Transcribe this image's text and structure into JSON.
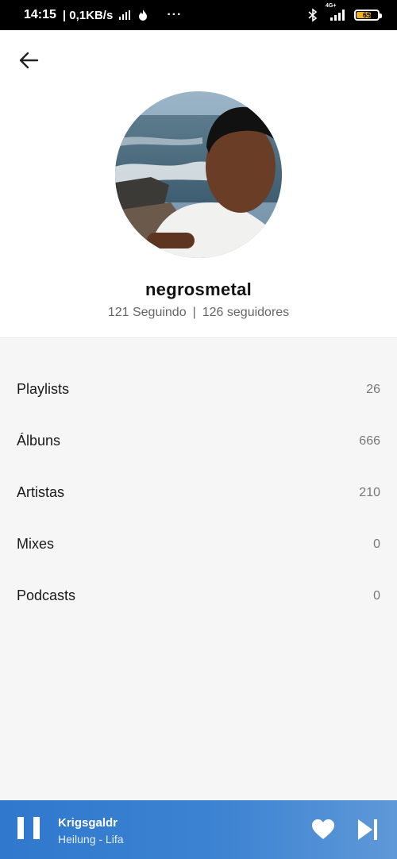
{
  "status_bar": {
    "time": "14:15",
    "network_speed": "| 0,1KB/s",
    "more": "···",
    "signal_type": "4G+",
    "battery_level": "65"
  },
  "profile": {
    "username": "negrosmetal",
    "following": "121 Seguindo",
    "separator": "|",
    "followers": "126 seguidores"
  },
  "library": {
    "items": [
      {
        "label": "Playlists",
        "count": "26"
      },
      {
        "label": "Álbuns",
        "count": "666"
      },
      {
        "label": "Artistas",
        "count": "210"
      },
      {
        "label": "Mixes",
        "count": "0"
      },
      {
        "label": "Podcasts",
        "count": "0"
      }
    ]
  },
  "player": {
    "title": "Krigsgaldr",
    "artist": "Heilung - Lifa",
    "colors": {
      "start": "#2f78cd",
      "end": "#5e98d8"
    }
  },
  "icons": {
    "back": "arrow-left-icon",
    "pause": "pause-icon",
    "like": "heart-icon",
    "next": "skip-next-icon"
  }
}
